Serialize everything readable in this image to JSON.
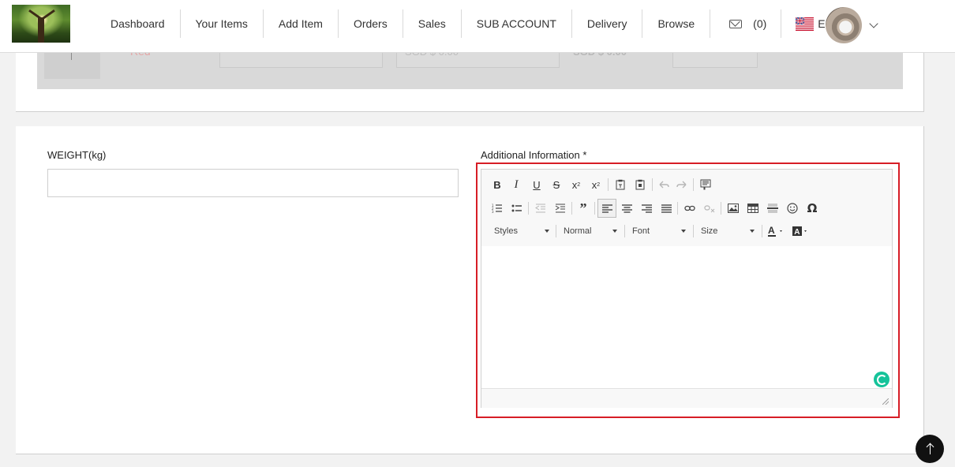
{
  "header": {
    "nav": [
      {
        "label": "Dashboard"
      },
      {
        "label": "Your Items"
      },
      {
        "label": "Add Item"
      },
      {
        "label": "Orders"
      },
      {
        "label": "Sales"
      },
      {
        "label": "SUB ACCOUNT"
      },
      {
        "label": "Delivery"
      },
      {
        "label": "Browse"
      }
    ],
    "messages_count": "(0)",
    "language": "EN"
  },
  "variant_row": {
    "color": "Red",
    "price": "SGD $ 0.00",
    "total": "SGD $ 0.00"
  },
  "form": {
    "weight_label": "WEIGHT(kg)",
    "weight_value": "",
    "additional_info_label": "Additional Information *"
  },
  "editor": {
    "styles": "Styles",
    "format": "Normal",
    "font": "Font",
    "size": "Size",
    "content": ""
  },
  "colors": {
    "highlight": "#d71d26",
    "grammarly": "#15c39a"
  }
}
